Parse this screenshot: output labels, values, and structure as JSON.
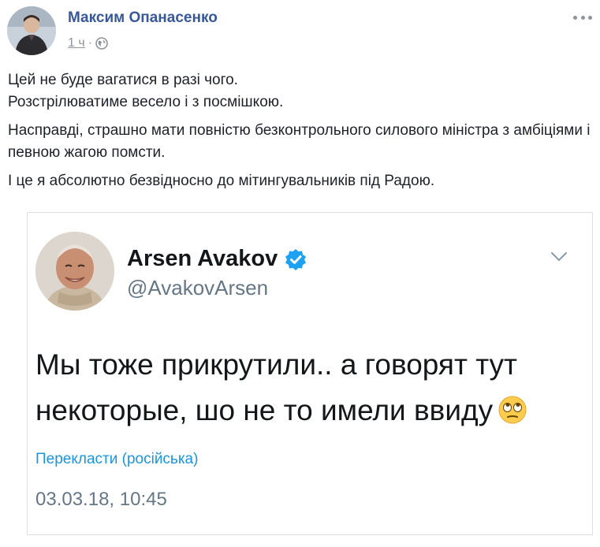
{
  "post": {
    "author": "Максим Опанасенко",
    "time": "1 ч",
    "separator": "·",
    "paragraphs": [
      "Цей не буде вагатися в разі чого.",
      "Розстрілюватиме весело і з посмішкою.",
      "Насправді, страшно мати повністю безконтрольного силового міністра з амбіціями і певною жагою помсти.",
      "І це я абсолютно безвідносно до мітингувальників під Радою."
    ]
  },
  "tweet": {
    "name": "Arsen Avakov",
    "handle": "@AvakovArsen",
    "body": "Мы тоже прикрутили.. а говорят тут некоторые, шо не то имели ввиду",
    "translate": "Перекласти (російська)",
    "date": "03.03.18, 10:45"
  },
  "colors": {
    "link": "#385898",
    "meta": "#90949c",
    "tweet_blue": "#1b95e0",
    "tweet_gray": "#657786"
  },
  "icons": [
    "globe-icon",
    "more-options-icon",
    "verified-badge-icon",
    "chevron-down-icon",
    "eye-roll-emoji"
  ]
}
